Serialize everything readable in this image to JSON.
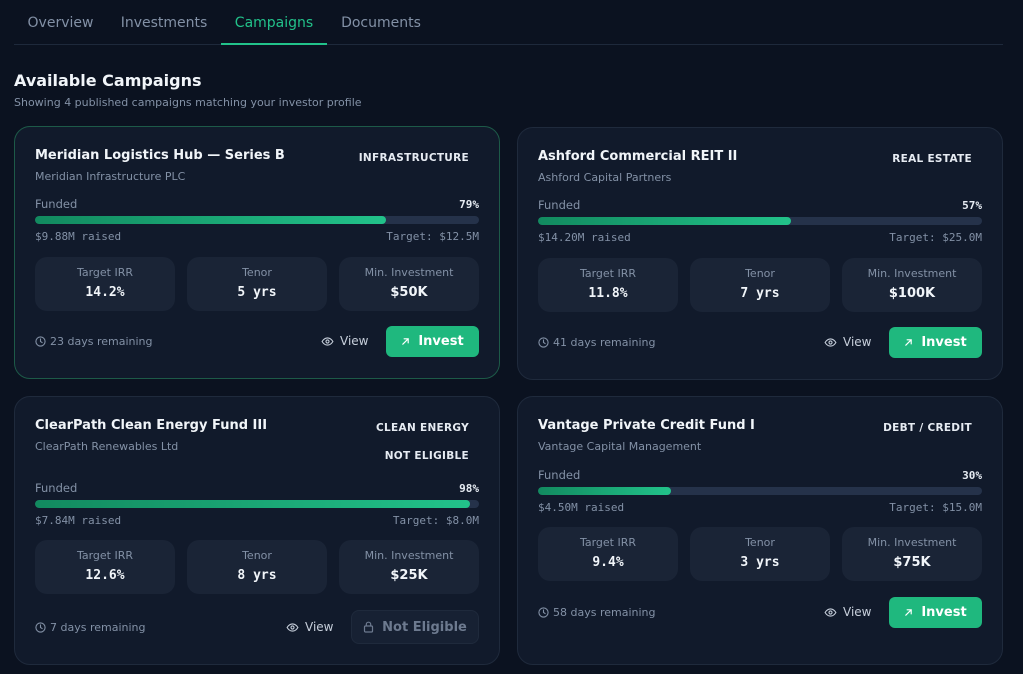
{
  "tabs": [
    {
      "label": "Overview",
      "active": false
    },
    {
      "label": "Investments",
      "active": false
    },
    {
      "label": "Campaigns",
      "active": true
    },
    {
      "label": "Documents",
      "active": false
    }
  ],
  "heading": "Available Campaigns",
  "subheading": "Showing 4 published campaigns matching your investor profile",
  "labels": {
    "funded": "Funded",
    "target_irr": "Target IRR",
    "tenor": "Tenor",
    "min_investment": "Min. Investment",
    "view": "View",
    "invest": "Invest",
    "not_eligible": "Not Eligible"
  },
  "campaigns": [
    {
      "title": "Meridian Logistics Hub — Series B",
      "issuer": "Meridian Infrastructure PLC",
      "category": "INFRASTRUCTURE",
      "funded_pct_label": "79%",
      "funded_fraction": 0.79,
      "raised": "$9.88M raised",
      "target": "Target: $12.5M",
      "irr": "14.2%",
      "tenor": "5 yrs",
      "min_investment": "$50K",
      "remaining": "23 days remaining",
      "eligible": true
    },
    {
      "title": "Ashford Commercial REIT II",
      "issuer": "Ashford Capital Partners",
      "category": "REAL ESTATE",
      "funded_pct_label": "57%",
      "funded_fraction": 0.57,
      "raised": "$14.20M raised",
      "target": "Target: $25.0M",
      "irr": "11.8%",
      "tenor": "7 yrs",
      "min_investment": "$100K",
      "remaining": "41 days remaining",
      "eligible": true
    },
    {
      "title": "ClearPath Clean Energy Fund III",
      "issuer": "ClearPath Renewables Ltd",
      "category": "CLEAN ENERGY",
      "eligibility_badge": "NOT ELIGIBLE",
      "funded_pct_label": "98%",
      "funded_fraction": 0.98,
      "raised": "$7.84M raised",
      "target": "Target: $8.0M",
      "irr": "12.6%",
      "tenor": "8 yrs",
      "min_investment": "$25K",
      "remaining": "7 days remaining",
      "eligible": false
    },
    {
      "title": "Vantage Private Credit Fund I",
      "issuer": "Vantage Capital Management",
      "category": "DEBT / CREDIT",
      "funded_pct_label": "30%",
      "funded_fraction": 0.3,
      "raised": "$4.50M raised",
      "target": "Target: $15.0M",
      "irr": "9.4%",
      "tenor": "3 yrs",
      "min_investment": "$75K",
      "remaining": "58 days remaining",
      "eligible": true
    }
  ],
  "colors": {
    "accent": "#22c28a",
    "button": "#1fb87e",
    "background": "#0b1220",
    "card": "#111a2b"
  },
  "icons": {
    "remaining": "clock-icon",
    "view": "eye-icon",
    "invest": "arrow-up-right-icon",
    "not_eligible": "lock-icon"
  }
}
